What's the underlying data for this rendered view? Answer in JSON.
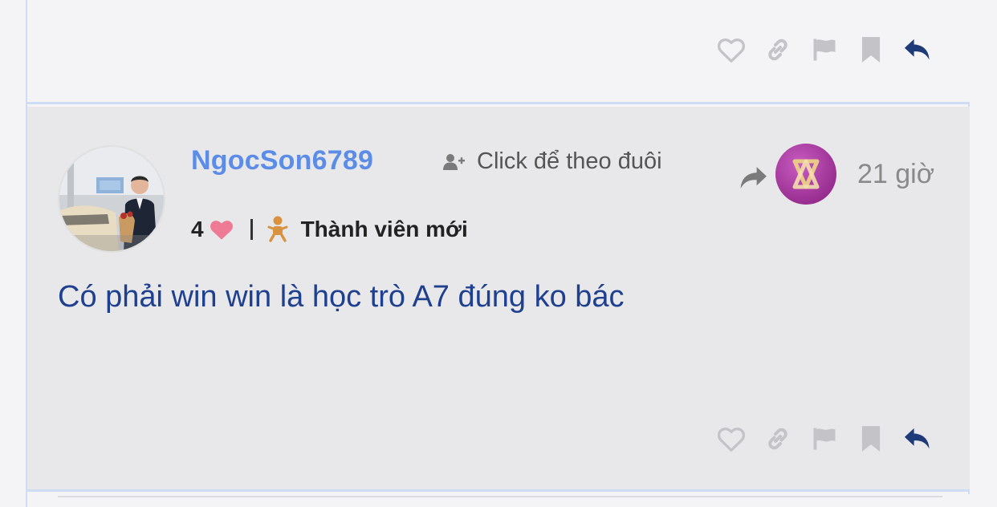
{
  "post": {
    "username": "NgocSon6789",
    "follow_label": "Click để theo đuôi",
    "likes_count": "4",
    "rank_label": "Thành viên mới",
    "time_ago": "21 giờ",
    "content": "Có phải win win là học trò A7 đúng ko bác"
  },
  "icons": {
    "like": "heart-outline-icon",
    "link": "link-icon",
    "report": "flag-icon",
    "bookmark": "bookmark-icon",
    "reply": "reply-icon",
    "share": "share-arrow-icon",
    "follow": "add-user-icon",
    "rank": "baby-icon"
  },
  "colors": {
    "username": "#5b8de8",
    "content_text": "#1f3f8f",
    "reply_icon": "#1f3a78",
    "action_icon": "#c4c4c8",
    "heart": "#ef7a95",
    "rank_icon": "#d9923f",
    "badge": "#a0309a",
    "post_bg": "#e8e8ea"
  }
}
